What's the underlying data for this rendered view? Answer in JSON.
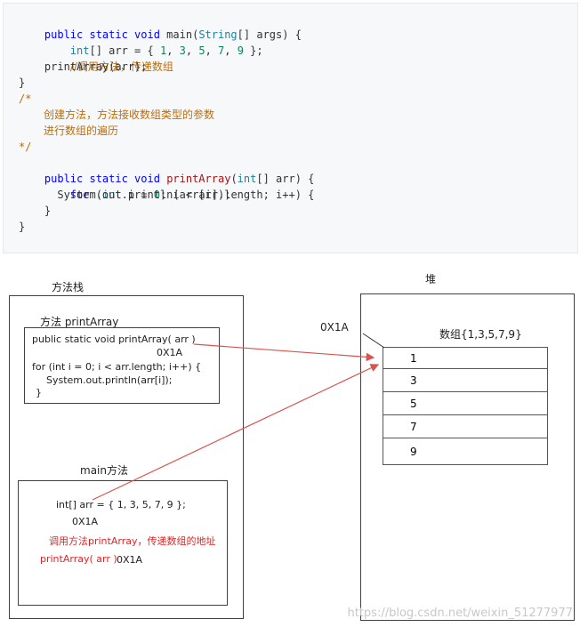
{
  "code": {
    "lines": [
      "public static void main(String[] args) {",
      "    int[] arr = { 1, 3, 5, 7, 9 };",
      "    //调用方法，传递数组",
      "    printArray(arr);",
      "}",
      "/*",
      "    创建方法，方法接收数组类型的参数",
      "    进行数组的遍历",
      "*/",
      "public static void printArray(int[] arr) {",
      "    for (int i = 0; i < arr.length; i++) {",
      "      System.out.println(arr[i]);",
      "    }",
      "}"
    ],
    "comment_chinese_1": "创建方法，方法接收数组类型的参数",
    "comment_chinese_2": "进行数组的遍历",
    "comment_inline": "//调用方法，传递数组"
  },
  "diagram": {
    "stack_title": "方法栈",
    "heap_title": "堆",
    "printArray_frame_title": "方法 printArray",
    "printArray_code_1": "public static void printArray( arr )",
    "printArray_addr": "0X1A",
    "printArray_code_2": "for (int i = 0; i < arr.length; i++) {",
    "printArray_code_3": "System.out.println(arr[i]);",
    "printArray_code_4": "}",
    "main_frame_title": "main方法",
    "main_code_1": "int[] arr = { 1, 3, 5, 7, 9 };",
    "main_addr": "0X1A",
    "main_note": "调用方法printArray，传递数组的地址",
    "main_call": "printArray( arr )",
    "main_call_addr": "0X1A",
    "heap_addr_label": "0X1A",
    "heap_array_title": "数组{1,3,5,7,9}",
    "heap_values": [
      "1",
      "3",
      "5",
      "7",
      "9"
    ]
  },
  "watermark": "https://blog.csdn.net/weixin_51277977",
  "colors": {
    "arrow": "#d9534f",
    "note": "#e32424"
  }
}
